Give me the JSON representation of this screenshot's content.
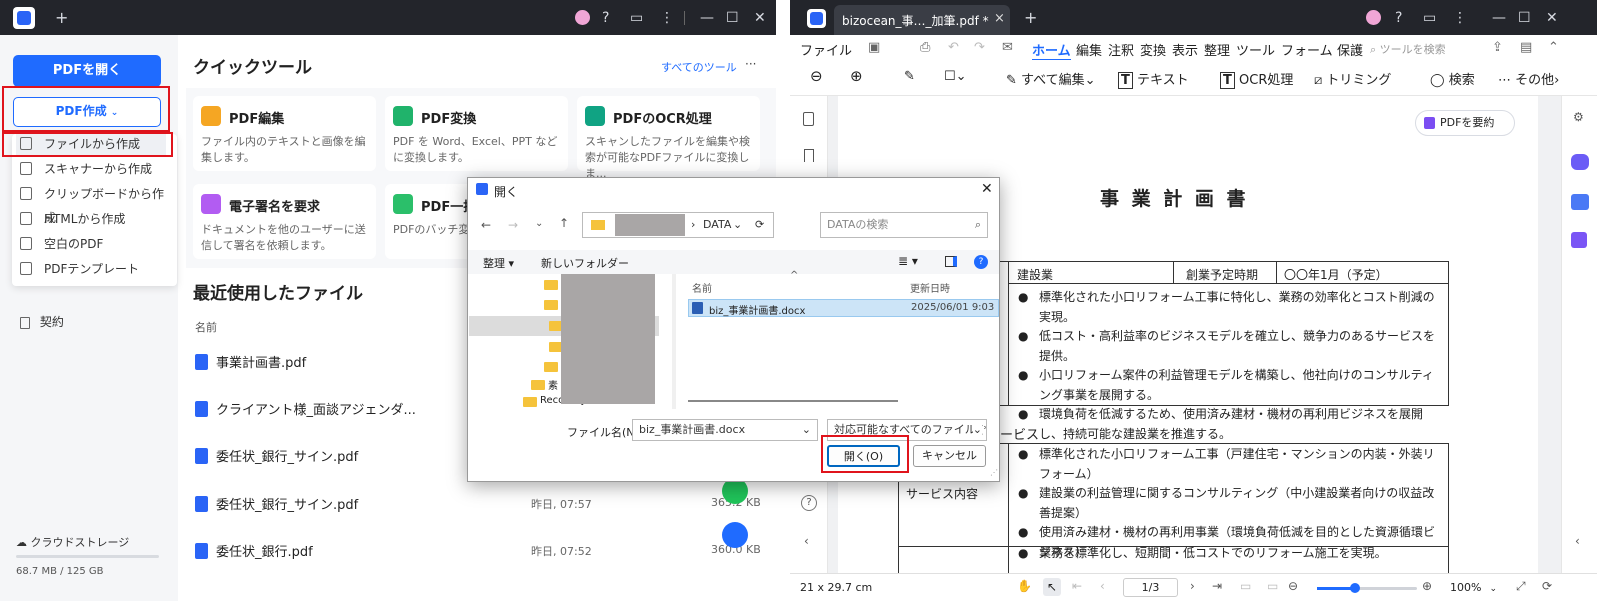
{
  "left": {
    "new_tab": "+",
    "open_pdf": "PDFを開く",
    "create_pdf": "PDF作成",
    "create_menu": [
      "ファイルから作成",
      "スキャナーから作成",
      "クリップボードから作成",
      "HTMLから作成",
      "空白のPDF",
      "PDFテンプレート"
    ],
    "contract": "契約",
    "cloud": "クラウドストレージ",
    "storage": "68.7 MB / 125 GB",
    "quick_tools_title": "クイックツール",
    "all_tools": "すべてのツール",
    "more": "···",
    "tools": [
      {
        "title": "PDF編集",
        "desc": "ファイル内のテキストと画像を編集します。"
      },
      {
        "title": "PDF変換",
        "desc": "PDF を Word、Excel、PPT などに変換します。"
      },
      {
        "title": "PDFのOCR処理",
        "desc": "スキャンしたファイルを編集や検索が可能なPDFファイルに変換しま..."
      },
      {
        "title": "電子署名を要求",
        "desc": "ドキュメントを他のユーザーに送信して署名を依頼します。"
      },
      {
        "title": "PDF一括",
        "desc": "PDFのバッチ変換OCRなど。"
      }
    ],
    "recent_title": "最近使用したファイル",
    "col_name": "名前",
    "recent_files": [
      {
        "name": "事業計画書.pdf",
        "time": "",
        "size": ""
      },
      {
        "name": "クライアント様_面談アジェンダ...",
        "time": "",
        "size": ""
      },
      {
        "name": "委任状_銀行_サイン.pdf",
        "time": "",
        "size": ""
      },
      {
        "name": "委任状_銀行_サイン.pdf",
        "time": "昨日, 07:57",
        "size": "365.2 KB"
      },
      {
        "name": "委任状_銀行.pdf",
        "time": "昨日, 07:52",
        "size": "360.0 KB"
      }
    ]
  },
  "right": {
    "tab_title": "bizocean_事…_加筆.pdf *",
    "close_tab": "×",
    "new_tab": "+",
    "menu": [
      "ファイル",
      "ホーム",
      "編集",
      "注釈",
      "変換",
      "表示",
      "整理",
      "ツール",
      "フォーム",
      "保護"
    ],
    "search_tools": "ツールを検索",
    "toolbar": [
      "すべて編集",
      "テキスト",
      "OCR処理",
      "トリミング",
      "検索",
      "その他"
    ],
    "summarize": "PDFを要約",
    "doc_title": "事 業 計 画 書",
    "row1": [
      "建設業",
      "創業予定時期",
      "〇〇年1月（予定）"
    ],
    "bullets1": [
      "標準化された小口リフォーム工事に特化し、業務の効率化とコスト削減の実現。",
      "低コスト・高利益率のビジネスモデルを確立し、競争力のあるサービスを提供。",
      "小口リフォーム案件の利益管理モデルを構築し、他社向けのコンサルティング事業を展開する。",
      "環境負荷を低減するため、使用済み建材・機材の再利用ビジネスを展開し、持続可能な建設業を推進する。"
    ],
    "section2": "ービス",
    "service_label": "サービス内容",
    "bullets2": [
      "標準化された小口リフォーム工事（戸建住宅・マンションの内装・外装リフォーム）",
      "建設業の利益管理に関するコンサルティング（中小建設業者向けの収益改善提案）",
      "使用済み建材・機材の再利用事業（環境負荷低減を目的とした資源循環ビジネス）"
    ],
    "bullets3": [
      "業務を標準化し、短期間・低コストでのリフォーム施工を実現。"
    ],
    "page_size": "21 x 29.7 cm",
    "page_num": "1/3",
    "zoom": "100%"
  },
  "dialog": {
    "title": "開く",
    "path_end": "DATA",
    "search_placeholder": "DATAの検索",
    "organize": "整理",
    "new_folder": "新しいフォルダー",
    "col_name": "名前",
    "col_date": "更新日時",
    "tree_items": [
      "素",
      "Recovery"
    ],
    "file_name": "biz_事業計画書.docx",
    "file_date": "2025/06/01 9:03",
    "filename_label": "ファイル名(N):",
    "filename_value": "biz_事業計画書.docx",
    "filter": "対応可能なすべてのファイル (*.*",
    "open_btn": "開く(O)",
    "cancel_btn": "キャンセル"
  }
}
